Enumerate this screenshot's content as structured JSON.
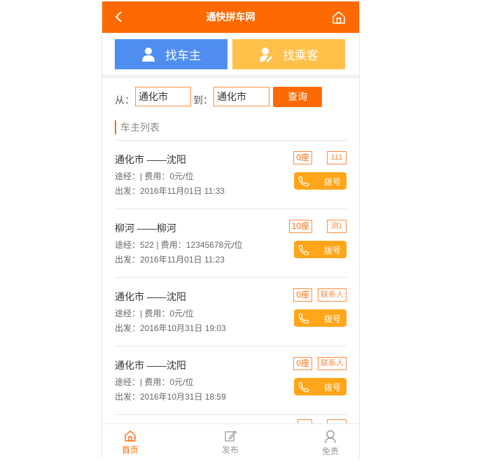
{
  "header": {
    "title": "通快拼车网"
  },
  "tabs": {
    "driver": "找车主",
    "passenger": "找乘客"
  },
  "search": {
    "from_label": "从：",
    "from_value": "通化市",
    "to_label": "到：",
    "to_value": "通化市",
    "button": "查询"
  },
  "section_title": "车主列表",
  "listings": [
    {
      "route": "通化市 ——沈阳",
      "via": "途经：| 费用：0元/位",
      "depart": "出发：2016年11月01日 11:33",
      "seats": "0座",
      "contact": "111",
      "dial": "拨号"
    },
    {
      "route": "柳河 ——柳河",
      "via": "途经：522 | 费用：12345678元/位",
      "depart": "出发：2016年11月01日 11:23",
      "seats": "10座",
      "contact": "测1",
      "dial": "拨号"
    },
    {
      "route": "通化市 ——沈阳",
      "via": "途经：| 费用：0元/位",
      "depart": "出发：2016年10月31日 19:03",
      "seats": "0座",
      "contact": "联系人",
      "dial": "拨号"
    },
    {
      "route": "通化市 ——沈阳",
      "via": "途经：| 费用：0元/位",
      "depart": "出发：2016年10月31日 18:59",
      "seats": "0座",
      "contact": "联系人",
      "dial": "拨号"
    }
  ],
  "footer": {
    "home": "首页",
    "publish": "发布",
    "disclaimer": "免责"
  },
  "colors": {
    "primary": "#ff6a00",
    "blue": "#4f8ef0",
    "yellow": "#ffc04a",
    "dial": "#ffa61a"
  }
}
